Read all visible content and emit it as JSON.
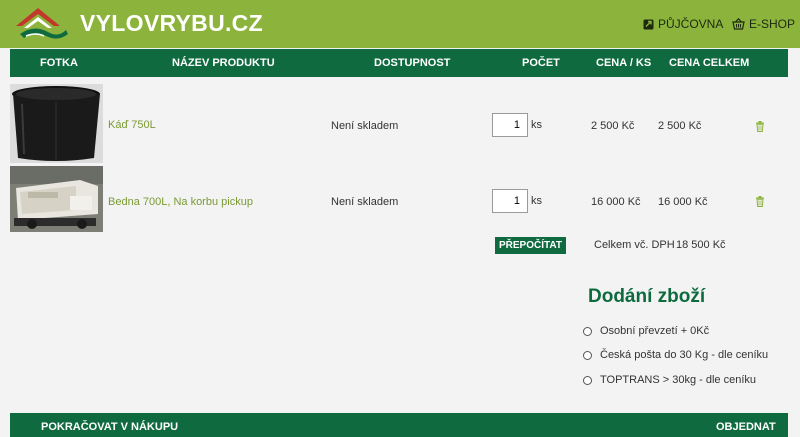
{
  "header": {
    "logo_text": "VYLOVRYBU.CZ",
    "nav": [
      {
        "label": "PŮJČOVNA",
        "icon": "rental-icon"
      },
      {
        "label": "E-SHOP",
        "icon": "basket-icon"
      }
    ],
    "colors": {
      "header_bg": "#8cb43c",
      "accent": "#0f6b3f",
      "link": "#7a9a34"
    }
  },
  "table": {
    "columns": [
      "FOTKA",
      "NÁZEV PRODUKTU",
      "DOSTUPNOST",
      "POČET",
      "CENA / KS",
      "CENA CELKEM"
    ],
    "rows": [
      {
        "name": "Káď 750L",
        "availability": "Není skladem",
        "qty": "1",
        "unit": "ks",
        "price": "2 500 Kč",
        "total": "2 500 Kč"
      },
      {
        "name": "Bedna 700L, Na korbu pickup",
        "availability": "Není skladem",
        "qty": "1",
        "unit": "ks",
        "price": "16 000 Kč",
        "total": "16 000 Kč"
      }
    ]
  },
  "cart": {
    "recalc_label": "PŘEPOČÍTAT",
    "total_label": "Celkem vč. DPH",
    "total_value": "18 500 Kč"
  },
  "delivery": {
    "title": "Dodání zboží",
    "options": [
      "Osobní převzetí + 0Kč",
      "Česká pošta do 30 Kg - dle ceníku",
      "TOPTRANS > 30kg - dle ceníku"
    ]
  },
  "footer": {
    "continue_label": "POKRAČOVAT V NÁKUPU",
    "order_label": "OBJEDNAT"
  }
}
